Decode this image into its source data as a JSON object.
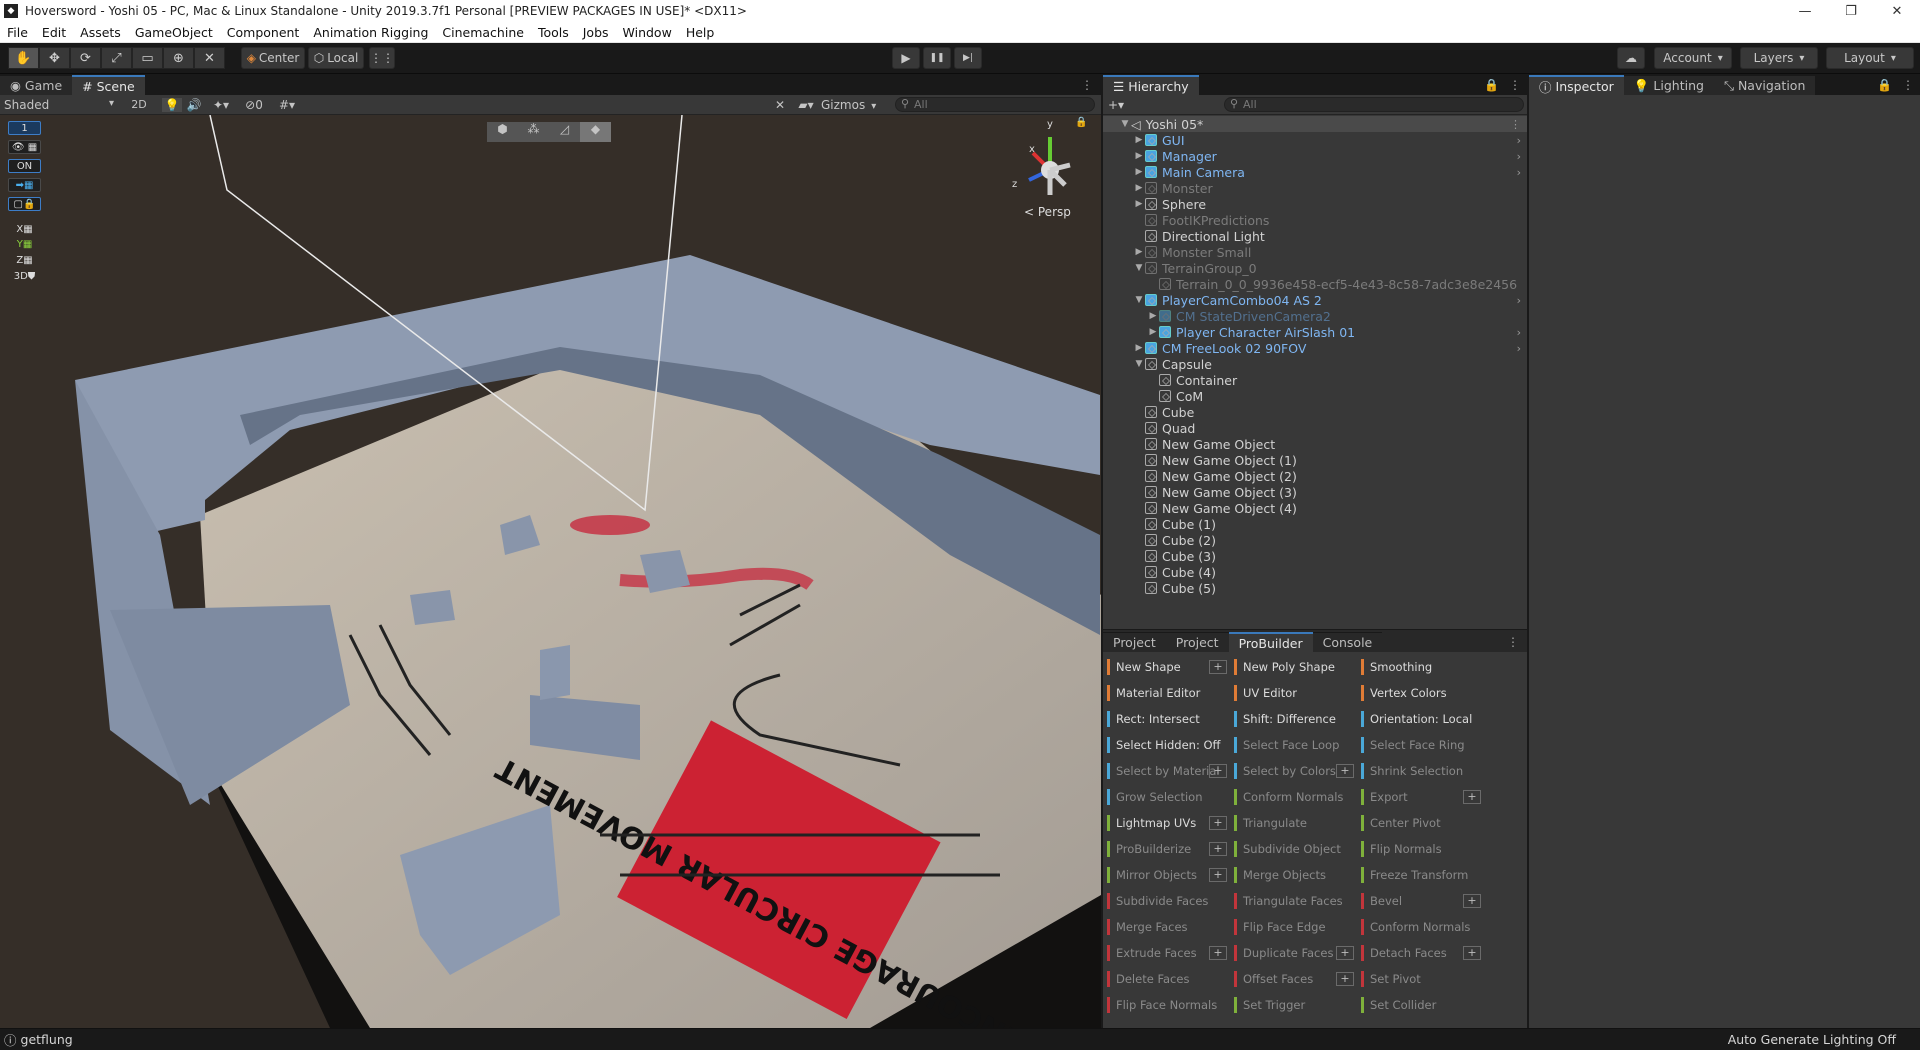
{
  "window": {
    "title": "Hoversword - Yoshi 05 - PC, Mac & Linux Standalone - Unity 2019.3.7f1 Personal [PREVIEW PACKAGES IN USE]* <DX11>",
    "app_icon": "unity-logo",
    "controls": [
      "—",
      "❐",
      "✕"
    ]
  },
  "menu": [
    "File",
    "Edit",
    "Assets",
    "GameObject",
    "Component",
    "Animation Rigging",
    "Cinemachine",
    "Tools",
    "Jobs",
    "Window",
    "Help"
  ],
  "toolbar": {
    "center_label": "Center",
    "local_label": "Local",
    "account_label": "Account",
    "layers_label": "Layers",
    "layout_label": "Layout",
    "play_icon": "▶",
    "pause_icon": "❚❚",
    "step_icon": "▶|"
  },
  "tabs": {
    "game": "Game",
    "scene": "Scene",
    "hierarchy": "Hierarchy",
    "inspector": "Inspector",
    "lighting": "Lighting",
    "navigation": "Navigation"
  },
  "scene_toolbar": {
    "shading_mode": "Shaded",
    "mode_2d": "2D",
    "hidden_count": "0",
    "gizmos": "Gizmos",
    "search_placeholder": "All"
  },
  "scene_sidebar": {
    "layer_value": "1",
    "on_label": "ON",
    "axis_x": "X",
    "axis_y": "Y",
    "axis_z": "Z",
    "mode_3d": "3D"
  },
  "viewport": {
    "persp_label": "Persp",
    "gizmo_y": "y",
    "gizmo_x": "x",
    "gizmo_z": "z",
    "sign_text": "ENCOURAGE CIRCULAR MOVEMENT"
  },
  "hierarchy": {
    "search_placeholder": "All",
    "root": "Yoshi 05*",
    "items": [
      {
        "label": "GUI",
        "type": "prefab",
        "arrow": "▶",
        "indent": 1
      },
      {
        "label": "Manager",
        "type": "prefab",
        "arrow": "▶",
        "indent": 1
      },
      {
        "label": "Main Camera",
        "type": "prefab",
        "arrow": "▶",
        "indent": 1
      },
      {
        "label": "Monster",
        "type": "dim",
        "arrow": "▶",
        "indent": 1
      },
      {
        "label": "Sphere",
        "type": "normal",
        "arrow": "▶",
        "indent": 1
      },
      {
        "label": "FootIKPredictions",
        "type": "dim",
        "arrow": "",
        "indent": 1
      },
      {
        "label": "Directional Light",
        "type": "normal",
        "arrow": "",
        "indent": 1
      },
      {
        "label": "Monster Small",
        "type": "dim",
        "arrow": "▶",
        "indent": 1
      },
      {
        "label": "TerrainGroup_0",
        "type": "dim",
        "arrow": "▼",
        "indent": 1
      },
      {
        "label": "Terrain_0_0_9936e458-ecf5-4e43-8c58-7adc3e8e2456",
        "type": "dim",
        "arrow": "",
        "indent": 2
      },
      {
        "label": "PlayerCamCombo04 AS 2",
        "type": "prefab",
        "arrow": "▼",
        "indent": 1
      },
      {
        "label": "CM StateDrivenCamera2",
        "type": "prefabdim",
        "arrow": "▶",
        "indent": 2
      },
      {
        "label": "Player Character AirSlash 01",
        "type": "prefab",
        "arrow": "▶",
        "indent": 2
      },
      {
        "label": "CM FreeLook 02 90FOV",
        "type": "prefab",
        "arrow": "▶",
        "indent": 1
      },
      {
        "label": "Capsule",
        "type": "normal",
        "arrow": "▼",
        "indent": 1
      },
      {
        "label": "Container",
        "type": "normal",
        "arrow": "",
        "indent": 2
      },
      {
        "label": "CoM",
        "type": "normal",
        "arrow": "",
        "indent": 2
      },
      {
        "label": "Cube",
        "type": "normal",
        "arrow": "",
        "indent": 1
      },
      {
        "label": "Quad",
        "type": "normal",
        "arrow": "",
        "indent": 1
      },
      {
        "label": "New Game Object",
        "type": "normal",
        "arrow": "",
        "indent": 1
      },
      {
        "label": "New Game Object (1)",
        "type": "normal",
        "arrow": "",
        "indent": 1
      },
      {
        "label": "New Game Object (2)",
        "type": "normal",
        "arrow": "",
        "indent": 1
      },
      {
        "label": "New Game Object (3)",
        "type": "normal",
        "arrow": "",
        "indent": 1
      },
      {
        "label": "New Game Object (4)",
        "type": "normal",
        "arrow": "",
        "indent": 1
      },
      {
        "label": "Cube (1)",
        "type": "normal",
        "arrow": "",
        "indent": 1
      },
      {
        "label": "Cube (2)",
        "type": "normal",
        "arrow": "",
        "indent": 1
      },
      {
        "label": "Cube (3)",
        "type": "normal",
        "arrow": "",
        "indent": 1
      },
      {
        "label": "Cube (4)",
        "type": "normal",
        "arrow": "",
        "indent": 1
      },
      {
        "label": "Cube (5)",
        "type": "normal",
        "arrow": "",
        "indent": 1
      }
    ]
  },
  "probuilder_tabs": [
    "Project",
    "Project",
    "ProBuilder",
    "Console"
  ],
  "probuilder": [
    [
      {
        "label": "New Shape",
        "color": "#e07c36",
        "plus": true,
        "on": true
      },
      {
        "label": "New Poly Shape",
        "color": "#e07c36",
        "on": true
      },
      {
        "label": "Smoothing",
        "color": "#e07c36",
        "on": true
      }
    ],
    [
      {
        "label": "Material Editor",
        "color": "#e07c36",
        "on": true
      },
      {
        "label": "UV Editor",
        "color": "#e07c36",
        "on": true
      },
      {
        "label": "Vertex Colors",
        "color": "#e07c36",
        "on": true
      }
    ],
    [
      {
        "label": "Rect: Intersect",
        "color": "#4aa8d8",
        "on": true
      },
      {
        "label": "Shift: Difference",
        "color": "#4aa8d8",
        "on": true
      },
      {
        "label": "Orientation: Local",
        "color": "#4aa8d8",
        "on": true
      }
    ],
    [
      {
        "label": "Select Hidden: Off",
        "color": "#4aa8d8",
        "on": true
      },
      {
        "label": "Select Face Loop",
        "color": "#4aa8d8",
        "on": false
      },
      {
        "label": "Select Face Ring",
        "color": "#4aa8d8",
        "on": false
      }
    ],
    [
      {
        "label": "Select by Material",
        "color": "#4aa8d8",
        "plus": true,
        "on": false
      },
      {
        "label": "Select by Colors",
        "color": "#4aa8d8",
        "plus": true,
        "on": false
      },
      {
        "label": "Shrink Selection",
        "color": "#4aa8d8",
        "on": false
      }
    ],
    [
      {
        "label": "Grow Selection",
        "color": "#4aa8d8",
        "on": false
      },
      {
        "label": "Conform Normals",
        "color": "#7fb13b",
        "on": false
      },
      {
        "label": "Export",
        "color": "#7fb13b",
        "plus": true,
        "on": false
      }
    ],
    [
      {
        "label": "Lightmap UVs",
        "color": "#7fb13b",
        "plus": true,
        "on": true
      },
      {
        "label": "Triangulate",
        "color": "#7fb13b",
        "on": false
      },
      {
        "label": "Center Pivot",
        "color": "#7fb13b",
        "on": false
      }
    ],
    [
      {
        "label": "ProBuilderize",
        "color": "#7fb13b",
        "plus": true,
        "on": false
      },
      {
        "label": "Subdivide Object",
        "color": "#7fb13b",
        "on": false
      },
      {
        "label": "Flip Normals",
        "color": "#7fb13b",
        "on": false
      }
    ],
    [
      {
        "label": "Mirror Objects",
        "color": "#7fb13b",
        "plus": true,
        "on": false
      },
      {
        "label": "Merge Objects",
        "color": "#7fb13b",
        "on": false
      },
      {
        "label": "Freeze Transform",
        "color": "#7fb13b",
        "on": false
      }
    ],
    [
      {
        "label": "Subdivide Faces",
        "color": "#c2353b",
        "on": false
      },
      {
        "label": "Triangulate Faces",
        "color": "#c2353b",
        "on": false
      },
      {
        "label": "Bevel",
        "color": "#c2353b",
        "plus": true,
        "on": false
      }
    ],
    [
      {
        "label": "Merge Faces",
        "color": "#c2353b",
        "on": false
      },
      {
        "label": "Flip Face Edge",
        "color": "#c2353b",
        "on": false
      },
      {
        "label": "Conform Normals",
        "color": "#c2353b",
        "on": false
      }
    ],
    [
      {
        "label": "Extrude Faces",
        "color": "#c2353b",
        "plus": true,
        "on": false
      },
      {
        "label": "Duplicate Faces",
        "color": "#c2353b",
        "plus": true,
        "on": false
      },
      {
        "label": "Detach Faces",
        "color": "#c2353b",
        "plus": true,
        "on": false
      }
    ],
    [
      {
        "label": "Delete Faces",
        "color": "#c2353b",
        "on": false
      },
      {
        "label": "Offset Faces",
        "color": "#c2353b",
        "plus": true,
        "on": false
      },
      {
        "label": "Set Pivot",
        "color": "#c2353b",
        "on": false
      }
    ],
    [
      {
        "label": "Flip Face Normals",
        "color": "#c2353b",
        "on": false
      },
      {
        "label": "Set Trigger",
        "color": "#7fb13b",
        "on": false
      },
      {
        "label": "Set Collider",
        "color": "#7fb13b",
        "on": false
      }
    ]
  ],
  "status": {
    "message": "getflung",
    "lighting": "Auto Generate Lighting Off"
  }
}
